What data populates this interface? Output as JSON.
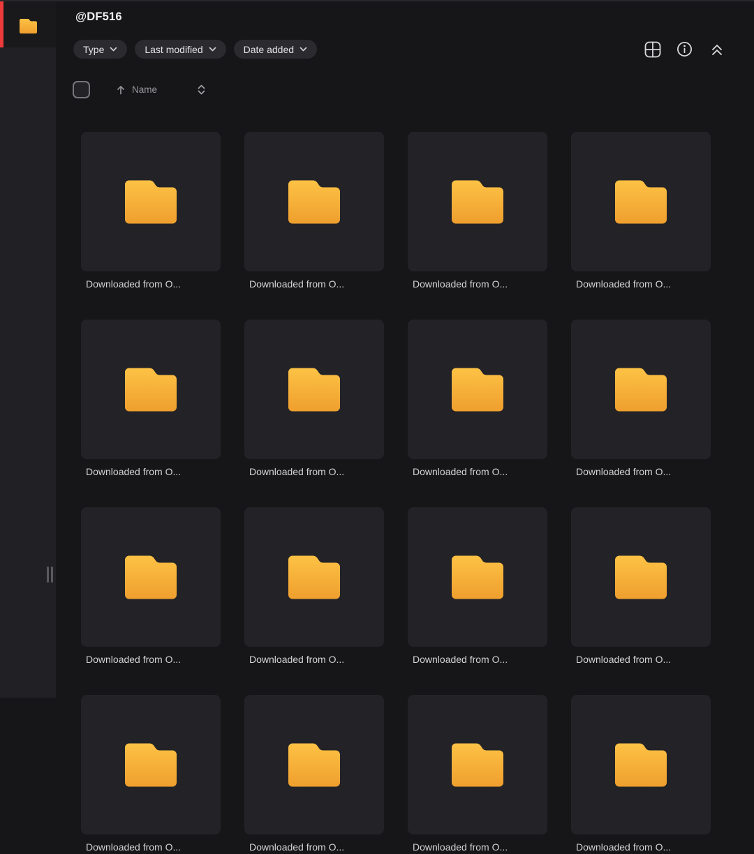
{
  "header": {
    "title": "@DF516"
  },
  "toolbar": {
    "filters": [
      {
        "label": "Type",
        "icon": "chevron-down-icon"
      },
      {
        "label": "Last modified",
        "icon": "chevron-down-icon"
      },
      {
        "label": "Date added",
        "icon": "chevron-down-icon"
      }
    ],
    "actions": [
      {
        "name": "grid-view-icon"
      },
      {
        "name": "info-icon"
      },
      {
        "name": "collapse-up-icon"
      }
    ]
  },
  "list_header": {
    "sort_label": "Name",
    "sort_direction": "ascending",
    "checkbox_checked": false
  },
  "sidebar": {
    "active_item": "folders",
    "accent_color": "#ee3a3a",
    "icon": "folder-icon"
  },
  "colors": {
    "background": "#161618",
    "sidebar": "#212125",
    "card": "#232327",
    "folder_top": "#fdc245",
    "folder_bottom": "#ef9f2e",
    "accent_red": "#ee3a3a"
  },
  "grid": {
    "items": [
      {
        "type": "folder",
        "label": "Downloaded from O..."
      },
      {
        "type": "folder",
        "label": "Downloaded from O..."
      },
      {
        "type": "folder",
        "label": "Downloaded from O..."
      },
      {
        "type": "folder",
        "label": "Downloaded from O..."
      },
      {
        "type": "folder",
        "label": "Downloaded from O..."
      },
      {
        "type": "folder",
        "label": "Downloaded from O..."
      },
      {
        "type": "folder",
        "label": "Downloaded from O..."
      },
      {
        "type": "folder",
        "label": "Downloaded from O..."
      },
      {
        "type": "folder",
        "label": "Downloaded from O..."
      },
      {
        "type": "folder",
        "label": "Downloaded from O..."
      },
      {
        "type": "folder",
        "label": "Downloaded from O..."
      },
      {
        "type": "folder",
        "label": "Downloaded from O..."
      },
      {
        "type": "folder",
        "label": "Downloaded from O..."
      },
      {
        "type": "folder",
        "label": "Downloaded from O..."
      },
      {
        "type": "folder",
        "label": "Downloaded from O..."
      },
      {
        "type": "folder",
        "label": "Downloaded from O..."
      }
    ]
  }
}
